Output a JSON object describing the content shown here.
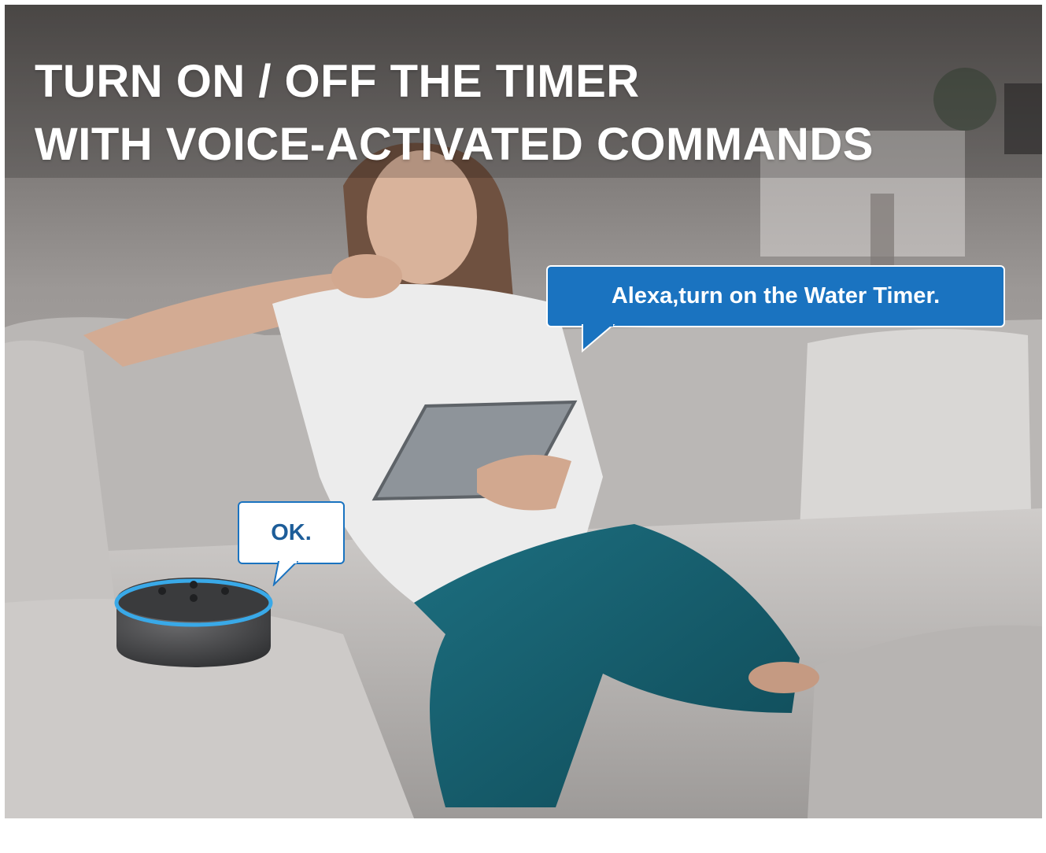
{
  "headline": {
    "line1": "TURN ON / OFF THE TIMER",
    "line2": "WITH VOICE-ACTIVATED COMMANDS"
  },
  "speech_bubbles": {
    "user": "Alexa,turn on the Water Timer.",
    "speaker": "OK."
  },
  "colors": {
    "bubble_blue": "#1a73c0",
    "headline_text": "#ffffff",
    "speaker_ring": "#39a9e8"
  }
}
